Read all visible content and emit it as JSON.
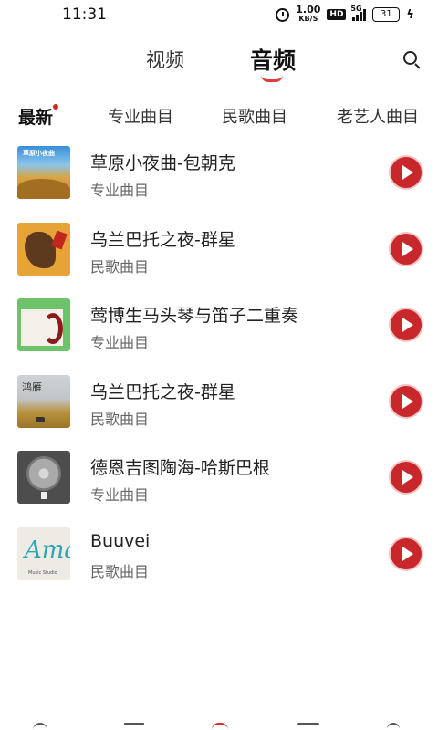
{
  "status_bar": {
    "time": "11:31",
    "net_speed_value": "1.00",
    "net_speed_unit": "KB/S",
    "hd_label": "HD",
    "network_label": "5G",
    "battery": "31",
    "icons": [
      "alarm-icon",
      "signal-icon",
      "battery-icon",
      "charging-icon"
    ]
  },
  "header": {
    "tabs": [
      {
        "label": "视频",
        "active": false
      },
      {
        "label": "音频",
        "active": true
      }
    ],
    "search_icon": "search-icon",
    "accent_color": "#e23b3b"
  },
  "categories": [
    {
      "label": "最新",
      "active": true,
      "badge": true
    },
    {
      "label": "专业曲目",
      "active": false
    },
    {
      "label": "民歌曲目",
      "active": false
    },
    {
      "label": "老艺人曲目",
      "active": false
    }
  ],
  "songs": [
    {
      "title": "草原小夜曲-包朝克",
      "category": "专业曲目",
      "cover_text": "草原小夜曲"
    },
    {
      "title": "乌兰巴托之夜-群星",
      "category": "民歌曲目",
      "cover_text": ""
    },
    {
      "title": "莺博生马头琴与笛子二重奏",
      "category": "专业曲目",
      "cover_text": ""
    },
    {
      "title": "乌兰巴托之夜-群星",
      "category": "民歌曲目",
      "cover_text": "鸿雁"
    },
    {
      "title": "德恩吉图陶海-哈斯巴根",
      "category": "专业曲目",
      "cover_text": ""
    },
    {
      "title": "Buuvei",
      "category": "民歌曲目",
      "cover_text": "Amaiz",
      "cover_sub": "Music Studio"
    }
  ],
  "play_button_color": "#c8282b",
  "bottom_nav_icons": [
    "home-icon",
    "list-icon",
    "center-icon",
    "message-icon",
    "profile-icon"
  ]
}
